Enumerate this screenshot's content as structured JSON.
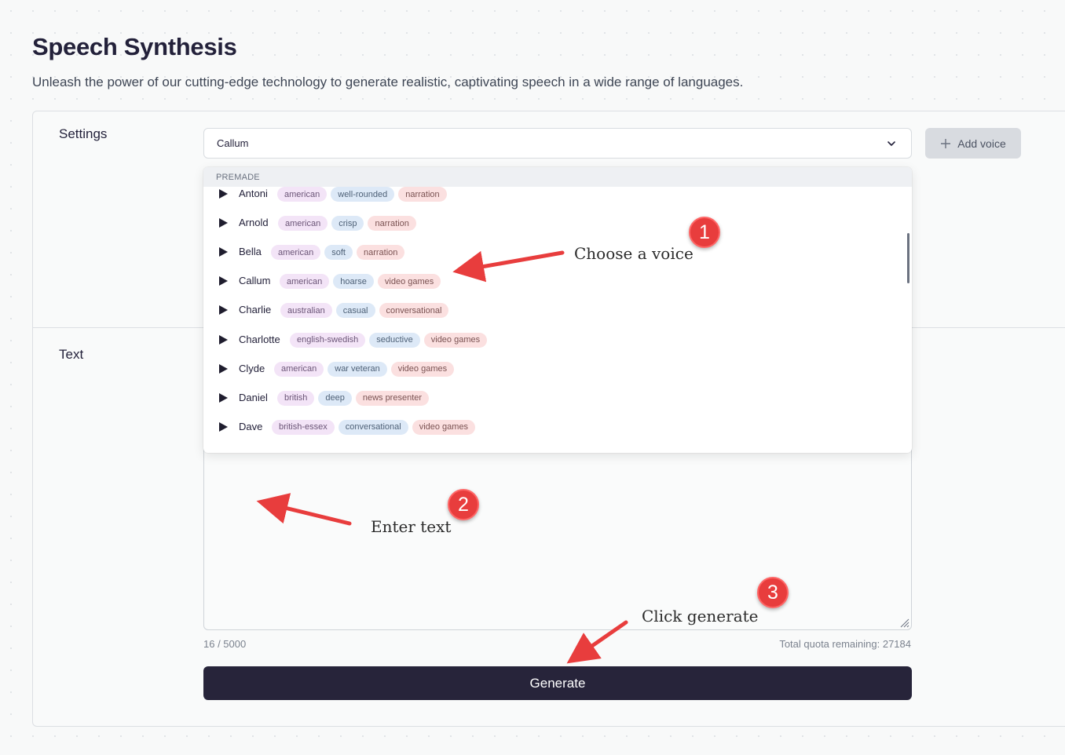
{
  "header": {
    "title": "Speech Synthesis",
    "subtitle": "Unleash the power of our cutting-edge technology to generate realistic, captivating speech in a wide range of languages."
  },
  "settings": {
    "label": "Settings",
    "selected_voice": "Callum",
    "add_voice_label": "Add voice",
    "dropdown_header": "PREMADE",
    "voices": [
      {
        "name": "Antoni",
        "tags": [
          "american",
          "well-rounded",
          "narration"
        ]
      },
      {
        "name": "Arnold",
        "tags": [
          "american",
          "crisp",
          "narration"
        ]
      },
      {
        "name": "Bella",
        "tags": [
          "american",
          "soft",
          "narration"
        ]
      },
      {
        "name": "Callum",
        "tags": [
          "american",
          "hoarse",
          "video games"
        ]
      },
      {
        "name": "Charlie",
        "tags": [
          "australian",
          "casual",
          "conversational"
        ]
      },
      {
        "name": "Charlotte",
        "tags": [
          "english-swedish",
          "seductive",
          "video games"
        ]
      },
      {
        "name": "Clyde",
        "tags": [
          "american",
          "war veteran",
          "video games"
        ]
      },
      {
        "name": "Daniel",
        "tags": [
          "british",
          "deep",
          "news presenter"
        ]
      },
      {
        "name": "Dave",
        "tags": [
          "british-essex",
          "conversational",
          "video games"
        ]
      }
    ]
  },
  "text": {
    "label": "Text",
    "char_count": "16 / 5000",
    "quota": "Total quota remaining: 27184"
  },
  "generate_label": "Generate",
  "annotations": {
    "step1_number": "1",
    "step1_text": "Choose a voice",
    "step2_number": "2",
    "step2_text": "Enter text",
    "step3_number": "3",
    "step3_text": "Click generate"
  },
  "colors": {
    "primary_button": "#27243a",
    "annotation_red": "#e83d3d",
    "tag_accent": "#f3e4f7",
    "tag_style": "#dde9f7",
    "tag_use": "#fbe0e0"
  },
  "icons": {
    "play": "play-icon",
    "chevron": "chevron-down-icon",
    "add": "plus-icon",
    "resize": "resize-grip-icon"
  }
}
